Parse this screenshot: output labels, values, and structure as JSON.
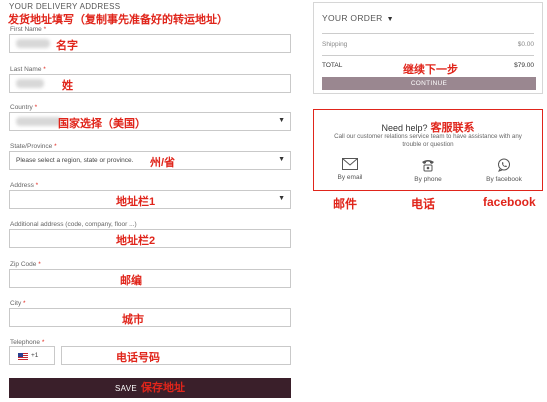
{
  "address_form": {
    "section_title": "YOUR DELIVERY ADDRESS",
    "instruction_annotation": "发货地址填写（复制事先准备好的转运地址）",
    "fields": {
      "first_name": {
        "label": "First Name",
        "required": "*",
        "annotation": "名字"
      },
      "last_name": {
        "label": "Last Name",
        "required": "*",
        "annotation": "姓"
      },
      "country": {
        "label": "Country",
        "required": "*",
        "annotation": "国家选择（美国）"
      },
      "state": {
        "label": "State/Province",
        "required": "*",
        "value": "Please select a region, state or province.",
        "annotation": "州/省"
      },
      "address": {
        "label": "Address",
        "required": "*",
        "annotation": "地址栏1"
      },
      "additional": {
        "label": "Additional address (code, company, floor ...)",
        "annotation": "地址栏2"
      },
      "zip": {
        "label": "Zip Code",
        "required": "*",
        "annotation": "邮编"
      },
      "city": {
        "label": "City",
        "required": "*",
        "annotation": "城市"
      },
      "telephone": {
        "label": "Telephone",
        "required": "*",
        "country_code": "+1",
        "annotation": "电话号码"
      }
    },
    "save_button": {
      "label": "SAVE",
      "annotation": "保存地址"
    }
  },
  "order_summary": {
    "title": "YOUR ORDER",
    "shipping_label": "Shipping",
    "shipping_value": "$0.00",
    "total_label": "TOTAL",
    "total_value": "$79.00",
    "continue_annotation": "继续下一步",
    "continue_label": "CONTINUE"
  },
  "help": {
    "title": "Need help?",
    "title_annotation": "客服联系",
    "text": "Call our customer relations service team to have assistance with any trouble or question",
    "contacts": [
      {
        "icon": "envelope-icon",
        "label": "By email",
        "annotation": "邮件"
      },
      {
        "icon": "telephone-icon",
        "label": "By phone",
        "annotation": "电话"
      },
      {
        "icon": "chat-icon",
        "label": "By facebook",
        "annotation": "facebook"
      }
    ]
  },
  "colors": {
    "annotation_red": "#e0251b",
    "save_button_bg": "#3a1f2a",
    "continue_button_bg": "#9a8790"
  }
}
